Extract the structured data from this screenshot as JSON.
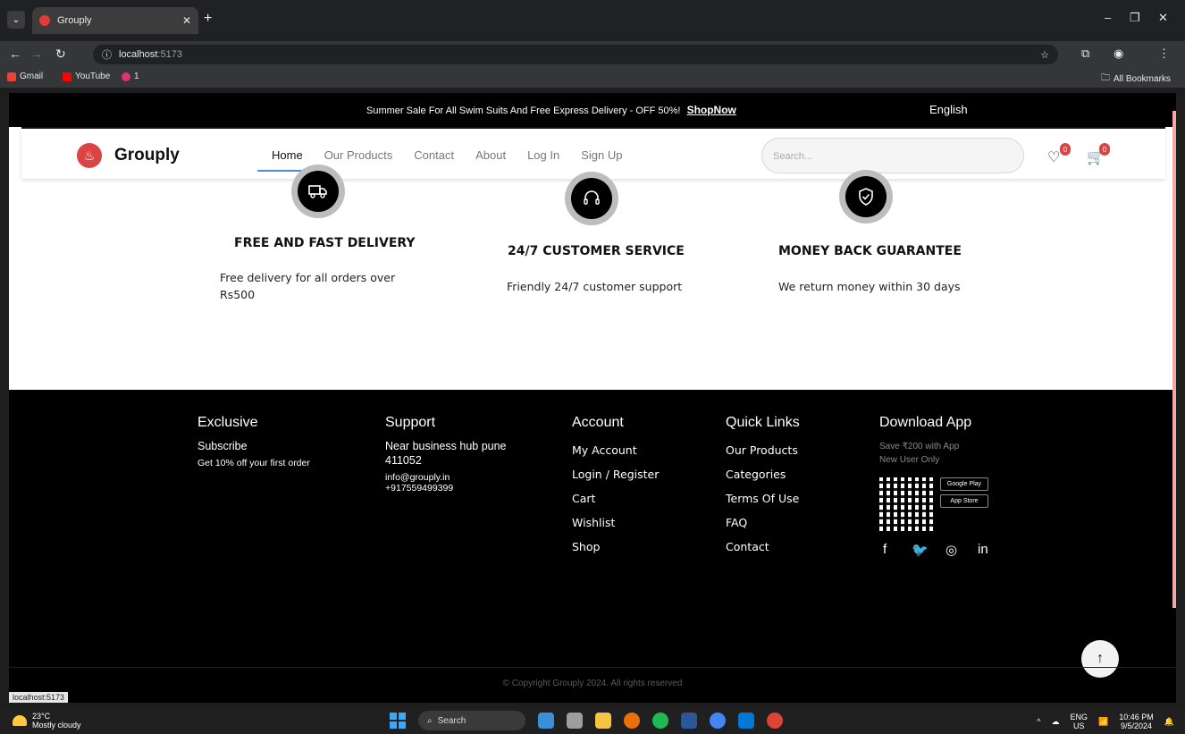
{
  "browser": {
    "tab_title": "Grouply",
    "url_host": "localhost",
    "url_port": ":5173",
    "status_url": "localhost:5173",
    "bookmarks": [
      {
        "label": "Gmail",
        "color": "#ea4335"
      },
      {
        "label": "YouTube",
        "color": "#ff0000"
      },
      {
        "label": "1",
        "color": "#e1306c"
      }
    ],
    "all_bookmarks": "All Bookmarks"
  },
  "promo": {
    "message": "Summer Sale For All Swim Suits And Free Express Delivery - OFF 50%!",
    "link": "ShopNow",
    "language": "English"
  },
  "header": {
    "brand": "Grouply",
    "nav": [
      "Home",
      "Our Products",
      "Contact",
      "About",
      "Log In",
      "Sign Up"
    ],
    "active_nav": "Home",
    "search_placeholder": "Search...",
    "wishlist_count": "0",
    "cart_count": "0",
    "accent_color": "#db4444"
  },
  "services": [
    {
      "icon": "delivery-truck-icon",
      "title": "FREE AND FAST DELIVERY",
      "desc": "Free delivery for all orders over Rs500"
    },
    {
      "icon": "headset-icon",
      "title": "24/7 CUSTOMER SERVICE",
      "desc": "Friendly 24/7 customer support"
    },
    {
      "icon": "shield-check-icon",
      "title": "MONEY BACK GUARANTEE",
      "desc": "We return money within 30 days"
    }
  ],
  "footer": {
    "exclusive": {
      "title": "Exclusive",
      "subscribe": "Subscribe",
      "offer": "Get 10% off your first order"
    },
    "support": {
      "title": "Support",
      "address_line1": "Near business hub pune",
      "address_line2": "411052",
      "email": "info@grouply.in",
      "phone": "+917559499399"
    },
    "account": {
      "title": "Account",
      "links": [
        "My Account",
        "Login / Register",
        "Cart",
        "Wishlist",
        "Shop"
      ]
    },
    "quick_links": {
      "title": "Quick Links",
      "links": [
        "Our Products",
        "Categories",
        "Terms Of Use",
        "FAQ",
        "Contact"
      ]
    },
    "download": {
      "title": "Download App",
      "save": "Save ₹200 with App",
      "new_user": "New User Only",
      "google_play": "Google Play",
      "app_store": "App Store"
    },
    "copyright": "© Copyright Grouply 2024. All rights reserved"
  },
  "taskbar": {
    "temperature": "23°C",
    "weather": "Mostly cloudy",
    "search": "Search",
    "lang_top": "ENG",
    "lang_bottom": "US",
    "time": "10:46 PM",
    "date": "9/5/2024"
  }
}
